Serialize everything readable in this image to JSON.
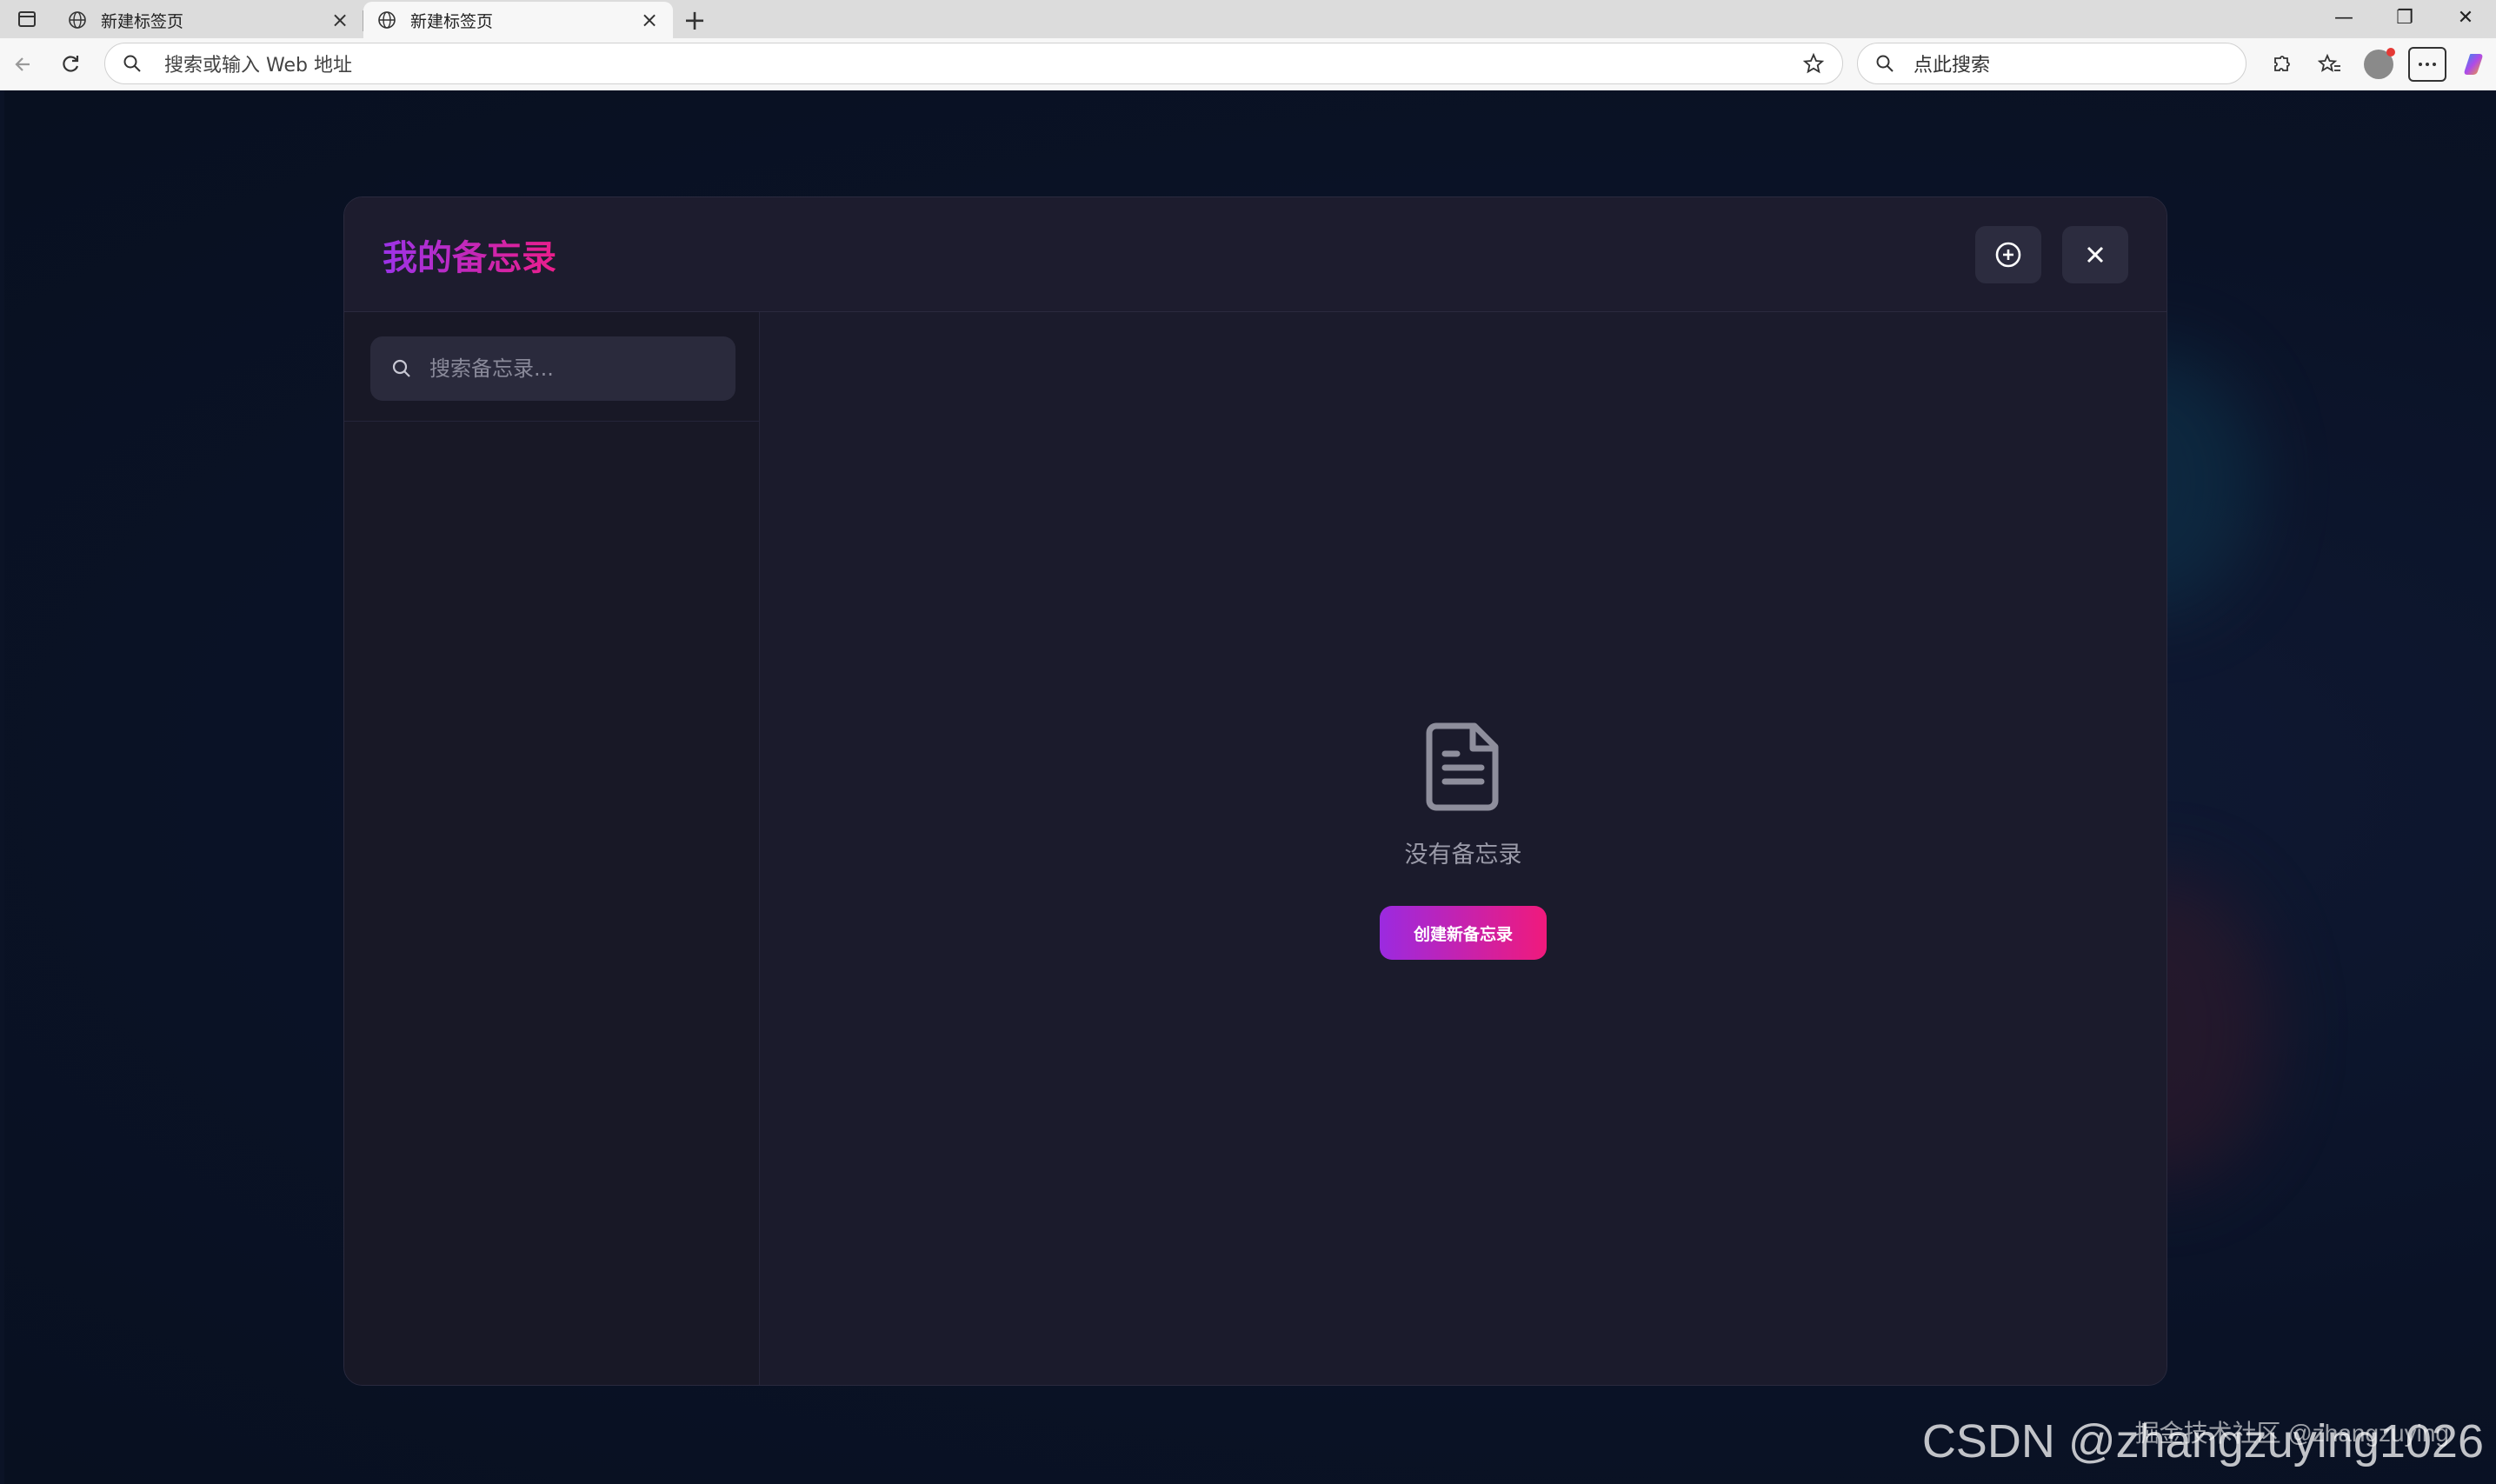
{
  "browser": {
    "tabs": [
      {
        "title": "新建标签页",
        "active": false
      },
      {
        "title": "新建标签页",
        "active": true
      }
    ],
    "address_placeholder": "搜索或输入 Web 地址",
    "search_placeholder": "点此搜索"
  },
  "modal": {
    "title": "我的备忘录",
    "search_placeholder": "搜索备忘录...",
    "empty_text": "没有备忘录",
    "create_button": "创建新备忘录"
  },
  "watermark": {
    "main": "CSDN @zhangzuying1026",
    "secondary": "掘金技术社区 @zhangzuying"
  },
  "colors": {
    "title_gradient_start": "#9b33e8",
    "title_gradient_end": "#ec1d8a",
    "modal_bg": "#1b1b2c",
    "page_bg": "#0b1326"
  }
}
